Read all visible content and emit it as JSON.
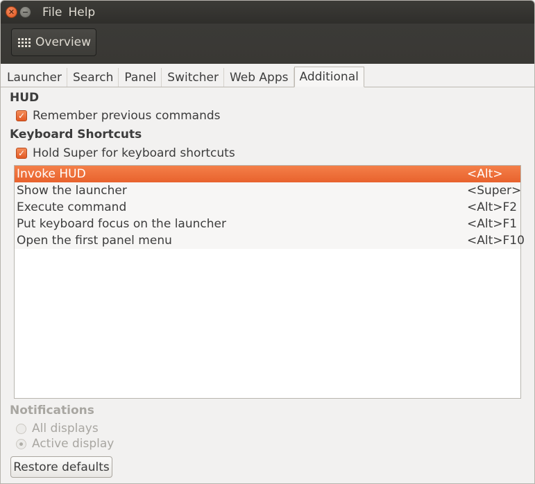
{
  "menu": [
    "File",
    "Help"
  ],
  "toolbar": {
    "overview_label": "Overview"
  },
  "tabs": [
    {
      "label": "Launcher"
    },
    {
      "label": "Search"
    },
    {
      "label": "Panel"
    },
    {
      "label": "Switcher"
    },
    {
      "label": "Web Apps"
    },
    {
      "label": "Additional",
      "active": true
    }
  ],
  "hud": {
    "title": "HUD",
    "remember_label": "Remember previous commands",
    "remember_checked": true
  },
  "keyboard": {
    "title": "Keyboard Shortcuts",
    "hold_super_label": "Hold Super for keyboard shortcuts",
    "hold_super_checked": true,
    "shortcuts": [
      {
        "name": "Invoke HUD",
        "key": "<Alt>",
        "selected": true
      },
      {
        "name": "Show the launcher",
        "key": "<Super>"
      },
      {
        "name": "Execute command",
        "key": "<Alt>F2"
      },
      {
        "name": "Put keyboard focus on the launcher",
        "key": "<Alt>F1"
      },
      {
        "name": "Open the first panel menu",
        "key": "<Alt>F10"
      }
    ]
  },
  "notifications": {
    "title": "Notifications",
    "options": [
      {
        "label": "All displays",
        "selected": false
      },
      {
        "label": "Active display",
        "selected": true
      }
    ]
  },
  "restore_label": "Restore defaults",
  "colors": {
    "accent": "#e8622d",
    "topbar": "#3c3b37",
    "background": "#f2f1f0"
  }
}
